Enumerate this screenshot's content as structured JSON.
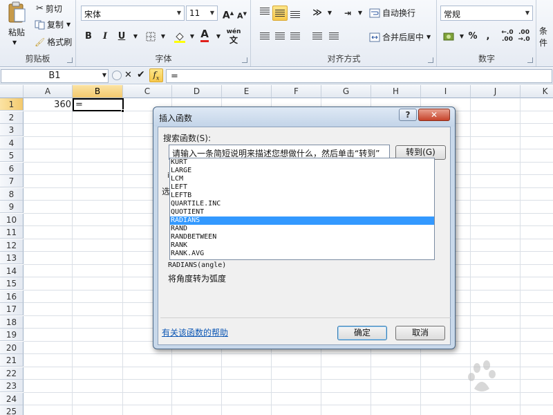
{
  "ribbon": {
    "clipboard": {
      "label": "剪贴板",
      "paste": "粘贴",
      "cut": "剪切",
      "copy": "复制",
      "format_painter": "格式刷"
    },
    "font": {
      "label": "字体",
      "font_name": "宋体",
      "font_size": "11",
      "bold": "B",
      "italic": "I",
      "underline": "U",
      "wen": "wén"
    },
    "alignment": {
      "label": "对齐方式",
      "wrap_text": "自动换行",
      "merge_center": "合并后居中"
    },
    "number": {
      "label": "数字",
      "format": "常规",
      "percent": "%",
      "comma": ","
    },
    "styles": {
      "conditional_partial": "条件"
    }
  },
  "formula_bar": {
    "name_box": "B1",
    "formula": "="
  },
  "grid": {
    "columns": [
      "A",
      "B",
      "C",
      "D",
      "E",
      "F",
      "G",
      "H",
      "I",
      "J",
      "K"
    ],
    "rows": [
      "1",
      "2",
      "3",
      "4",
      "5",
      "6",
      "7",
      "8",
      "9",
      "10",
      "11",
      "12",
      "13",
      "14",
      "15",
      "16",
      "17",
      "18",
      "19",
      "20",
      "21",
      "22",
      "23",
      "24",
      "25"
    ],
    "cells": {
      "A1": "360",
      "B1": "="
    }
  },
  "dialog": {
    "title": "插入函数",
    "help_button": "?",
    "close_button": "✕",
    "search_label": "搜索函数(S):",
    "search_placeholder": "请输入一条简短说明来描述您想做什么，然后单击“转到”",
    "goto_button": "转到(G)",
    "partial_label_1": "i",
    "partial_label_2": "选",
    "functions": [
      "KURT",
      "LARGE",
      "LCM",
      "LEFT",
      "LEFTB",
      "QUARTILE.INC",
      "QUOTIENT",
      "RADIANS",
      "RAND",
      "RANDBETWEEN",
      "RANK",
      "RANK.AVG"
    ],
    "selected_function": "RADIANS",
    "signature": "RADIANS(angle)",
    "description": "将角度转为弧度",
    "help_link": "有关该函数的帮助",
    "ok_button": "确定",
    "cancel_button": "取消"
  }
}
